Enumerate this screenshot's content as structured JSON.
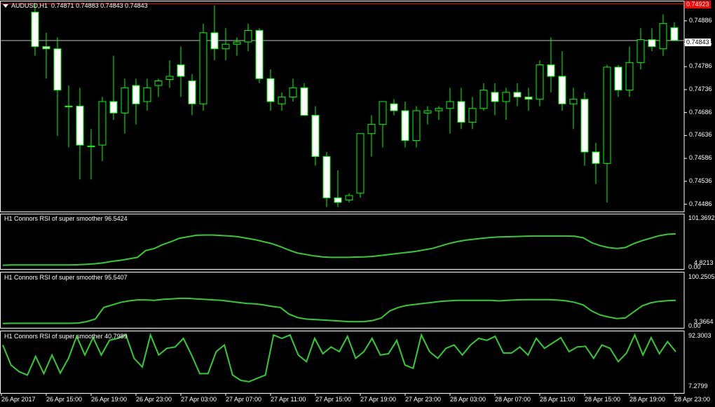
{
  "colors": {
    "background": "#000000",
    "grid_border": "#ffffff",
    "candle_line": "#00ff00",
    "bull_fill": "#000000",
    "bear_fill": "#ffffff",
    "indicator_line": "#32cd32",
    "price_line": "#c0c0c0",
    "ask_line": "#ff0000",
    "text": "#ffffff"
  },
  "header": {
    "arrow_icon": "triangle-down-icon",
    "symbol": "AUDUSD,H1",
    "ohlc": "0.74871 0.74883 0.74843 0.74843"
  },
  "price_axis": {
    "ticks": [
      "0.74886",
      "0.74836",
      "0.74786",
      "0.74736",
      "0.74686",
      "0.74636",
      "0.74586",
      "0.74536",
      "0.74486"
    ],
    "ask_tag": "0.74923",
    "bid_tag": "0.74843"
  },
  "time_axis": {
    "labels": [
      "26 Apr 2017",
      "26 Apr 15:00",
      "26 Apr 19:00",
      "26 Apr 23:00",
      "27 Apr 03:00",
      "27 Apr 07:00",
      "27 Apr 11:00",
      "27 Apr 15:00",
      "27 Apr 19:00",
      "27 Apr 23:00",
      "28 Apr 03:00",
      "28 Apr 07:00",
      "28 Apr 11:00",
      "28 Apr 15:00",
      "28 Apr 19:00",
      "28 Apr 23:00"
    ]
  },
  "indicators": [
    {
      "title": "H1 Connors RSI of super smoother 96.5424",
      "axis_max": "101.3692",
      "axis_min": "4.8213",
      "axis_zero": "0.00"
    },
    {
      "title": "H1 Connors RSI of super smoother 95.5407",
      "axis_max": "100.2505",
      "axis_min": "3.3664",
      "axis_zero": "0.00"
    },
    {
      "title": "H1 Connors RSI of super smoother 40.7989",
      "axis_max": "92.3003",
      "axis_min": "7.2799"
    }
  ],
  "chart_data": [
    {
      "type": "candlestick",
      "title": "AUDUSD,H1",
      "ylim": [
        0.7447,
        0.7493
      ],
      "candles": [
        [
          0.74905,
          0.74923,
          0.7481,
          0.7483
        ],
        [
          0.7483,
          0.7486,
          0.7476,
          0.74825
        ],
        [
          0.74825,
          0.7485,
          0.74635,
          0.74735
        ],
        [
          0.747,
          0.74745,
          0.7461,
          0.747
        ],
        [
          0.747,
          0.7474,
          0.7454,
          0.74615
        ],
        [
          0.74613,
          0.7465,
          0.7454,
          0.74613
        ],
        [
          0.74615,
          0.7472,
          0.7458,
          0.7471
        ],
        [
          0.7471,
          0.7481,
          0.7467,
          0.74685
        ],
        [
          0.74685,
          0.7476,
          0.7464,
          0.7474
        ],
        [
          0.74745,
          0.7476,
          0.7466,
          0.74705
        ],
        [
          0.7471,
          0.7476,
          0.7469,
          0.7474
        ],
        [
          0.74745,
          0.7476,
          0.7472,
          0.74755
        ],
        [
          0.74758,
          0.748,
          0.7474,
          0.74765
        ],
        [
          0.7479,
          0.7483,
          0.7472,
          0.74765
        ],
        [
          0.74755,
          0.7477,
          0.7468,
          0.74705
        ],
        [
          0.74705,
          0.7488,
          0.7469,
          0.7486
        ],
        [
          0.7486,
          0.7492,
          0.748,
          0.74825
        ],
        [
          0.74825,
          0.7487,
          0.748,
          0.74835
        ],
        [
          0.74835,
          0.7485,
          0.7481,
          0.7484
        ],
        [
          0.7484,
          0.7488,
          0.7482,
          0.74865
        ],
        [
          0.74865,
          0.7487,
          0.7475,
          0.7476
        ],
        [
          0.7476,
          0.7478,
          0.7469,
          0.7471
        ],
        [
          0.74705,
          0.7473,
          0.7469,
          0.7472
        ],
        [
          0.7472,
          0.7476,
          0.7471,
          0.7474
        ],
        [
          0.7474,
          0.7475,
          0.7468,
          0.7468
        ],
        [
          0.7468,
          0.747,
          0.7457,
          0.7459
        ],
        [
          0.7459,
          0.746,
          0.7448,
          0.745
        ],
        [
          0.745,
          0.7456,
          0.7448,
          0.7449
        ],
        [
          0.74495,
          0.7451,
          0.7449,
          0.74505
        ],
        [
          0.7451,
          0.7464,
          0.745,
          0.7464
        ],
        [
          0.7464,
          0.7468,
          0.7459,
          0.7466
        ],
        [
          0.7466,
          0.7471,
          0.7461,
          0.7471
        ],
        [
          0.74705,
          0.74715,
          0.7468,
          0.7469
        ],
        [
          0.7469,
          0.7471,
          0.7461,
          0.74625
        ],
        [
          0.74625,
          0.747,
          0.7461,
          0.7469
        ],
        [
          0.74685,
          0.747,
          0.7466,
          0.7469
        ],
        [
          0.7469,
          0.747,
          0.7467,
          0.74695
        ],
        [
          0.74695,
          0.7474,
          0.7464,
          0.7471
        ],
        [
          0.7471,
          0.7474,
          0.7465,
          0.74665
        ],
        [
          0.74665,
          0.7472,
          0.7465,
          0.74695
        ],
        [
          0.74695,
          0.7475,
          0.7469,
          0.74735
        ],
        [
          0.7473,
          0.7475,
          0.7468,
          0.7471
        ],
        [
          0.7471,
          0.7474,
          0.7467,
          0.7473
        ],
        [
          0.7473,
          0.7475,
          0.747,
          0.7472
        ],
        [
          0.7472,
          0.7474,
          0.7469,
          0.74715
        ],
        [
          0.74715,
          0.748,
          0.747,
          0.7479
        ],
        [
          0.7479,
          0.7485,
          0.7473,
          0.74765
        ],
        [
          0.74765,
          0.7482,
          0.7469,
          0.74705
        ],
        [
          0.74705,
          0.7474,
          0.7465,
          0.74715
        ],
        [
          0.74715,
          0.7473,
          0.7457,
          0.746
        ],
        [
          0.746,
          0.7462,
          0.7453,
          0.74575
        ],
        [
          0.74575,
          0.7479,
          0.7449,
          0.74785
        ],
        [
          0.74785,
          0.7479,
          0.7472,
          0.74735
        ],
        [
          0.74735,
          0.7483,
          0.7472,
          0.74795
        ],
        [
          0.74795,
          0.7487,
          0.7478,
          0.74845
        ],
        [
          0.74845,
          0.7487,
          0.7482,
          0.7483
        ],
        [
          0.74825,
          0.749,
          0.7481,
          0.7488
        ],
        [
          0.74871,
          0.74883,
          0.74843,
          0.74843
        ]
      ]
    },
    {
      "type": "line",
      "title": "H1 Connors RSI of super smoother 96.5424",
      "ylim": [
        0,
        101.3692
      ],
      "values": [
        2,
        2.5,
        2.5,
        2.5,
        2.5,
        2.5,
        2.5,
        2.5,
        2.5,
        3,
        4,
        5,
        7,
        10,
        12,
        15,
        18,
        32,
        36,
        44,
        50,
        57,
        60,
        63,
        63.5,
        63.5,
        62.5,
        61.5,
        60,
        57,
        54,
        50,
        46,
        40,
        33,
        27,
        24,
        21,
        19,
        18,
        18,
        18,
        18.5,
        19,
        20,
        22,
        24,
        26,
        28,
        30,
        33,
        36,
        41,
        46,
        50,
        53,
        55,
        57,
        58.5,
        59.5,
        60,
        60.5,
        61,
        61.5,
        61.5,
        61.5,
        61.5,
        61.5,
        61,
        58,
        48,
        42,
        38,
        36,
        38,
        46,
        52,
        57,
        62,
        65,
        66
      ]
    },
    {
      "type": "line",
      "title": "H1 Connors RSI of super smoother 95.5407",
      "ylim": [
        0,
        100.2505
      ],
      "values": [
        3,
        3.5,
        3.5,
        3.5,
        3.5,
        3.5,
        3.5,
        3.5,
        3.5,
        4,
        7,
        12,
        35,
        40,
        45,
        48,
        50,
        50,
        49,
        51,
        52,
        53,
        53,
        52,
        51,
        50,
        49,
        47,
        45,
        43,
        42,
        40,
        37,
        35,
        22,
        15,
        12,
        11,
        10,
        9,
        8,
        7,
        6.5,
        7,
        9,
        14,
        28,
        35,
        39,
        41,
        43,
        45,
        47,
        48,
        49,
        49,
        49,
        49,
        49,
        48,
        49,
        50,
        50.5,
        50.5,
        50.5,
        50.5,
        49.5,
        48,
        45,
        40,
        28,
        20,
        16,
        13,
        14,
        26,
        38,
        44,
        47,
        48.5,
        49
      ]
    },
    {
      "type": "line",
      "title": "H1 Connors RSI of super smoother 40.7989",
      "ylim": [
        7.2799,
        92.3003
      ],
      "values": [
        75,
        45,
        35,
        30,
        58,
        32,
        60,
        33,
        55,
        88,
        60,
        86,
        60,
        82,
        85,
        90,
        55,
        42,
        90,
        60,
        70,
        72,
        85,
        60,
        32,
        32,
        65,
        75,
        30,
        22,
        20,
        25,
        30,
        90,
        85,
        90,
        60,
        50,
        85,
        62,
        72,
        65,
        88,
        55,
        65,
        85,
        60,
        62,
        82,
        45,
        40,
        90,
        65,
        55,
        70,
        75,
        60,
        75,
        85,
        82,
        88,
        63,
        63,
        72,
        60,
        85,
        70,
        78,
        86,
        65,
        72,
        73,
        55,
        75,
        70,
        50,
        63,
        90,
        60,
        86,
        62,
        80,
        65
      ]
    }
  ]
}
